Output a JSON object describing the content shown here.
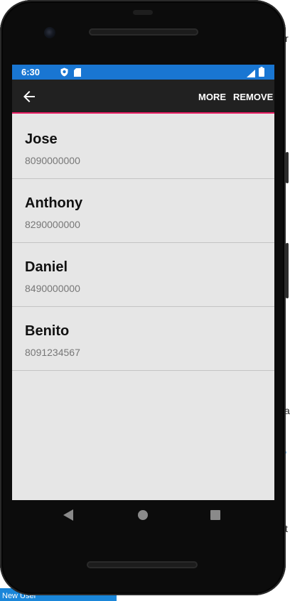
{
  "status_bar": {
    "time": "6:30"
  },
  "toolbar": {
    "more_label": "MORE",
    "remove_label": "REMOVE",
    "colors": {
      "background": "#212121",
      "accent": "#e91e63"
    }
  },
  "contacts": [
    {
      "name": "Jose",
      "phone": "8090000000"
    },
    {
      "name": "Anthony",
      "phone": "8290000000"
    },
    {
      "name": "Daniel",
      "phone": "8490000000"
    },
    {
      "name": "Benito",
      "phone": "8091234567"
    }
  ],
  "taskbar": {
    "tab_label": "New User"
  },
  "icons": {
    "status": [
      "shield-icon",
      "sd-card-icon",
      "signal-icon",
      "battery-icon"
    ],
    "nav": [
      "back-triangle-icon",
      "home-circle-icon",
      "recents-square-icon"
    ]
  },
  "colors": {
    "status_bar": "#1976d2",
    "list_background": "#e6e6e6"
  }
}
